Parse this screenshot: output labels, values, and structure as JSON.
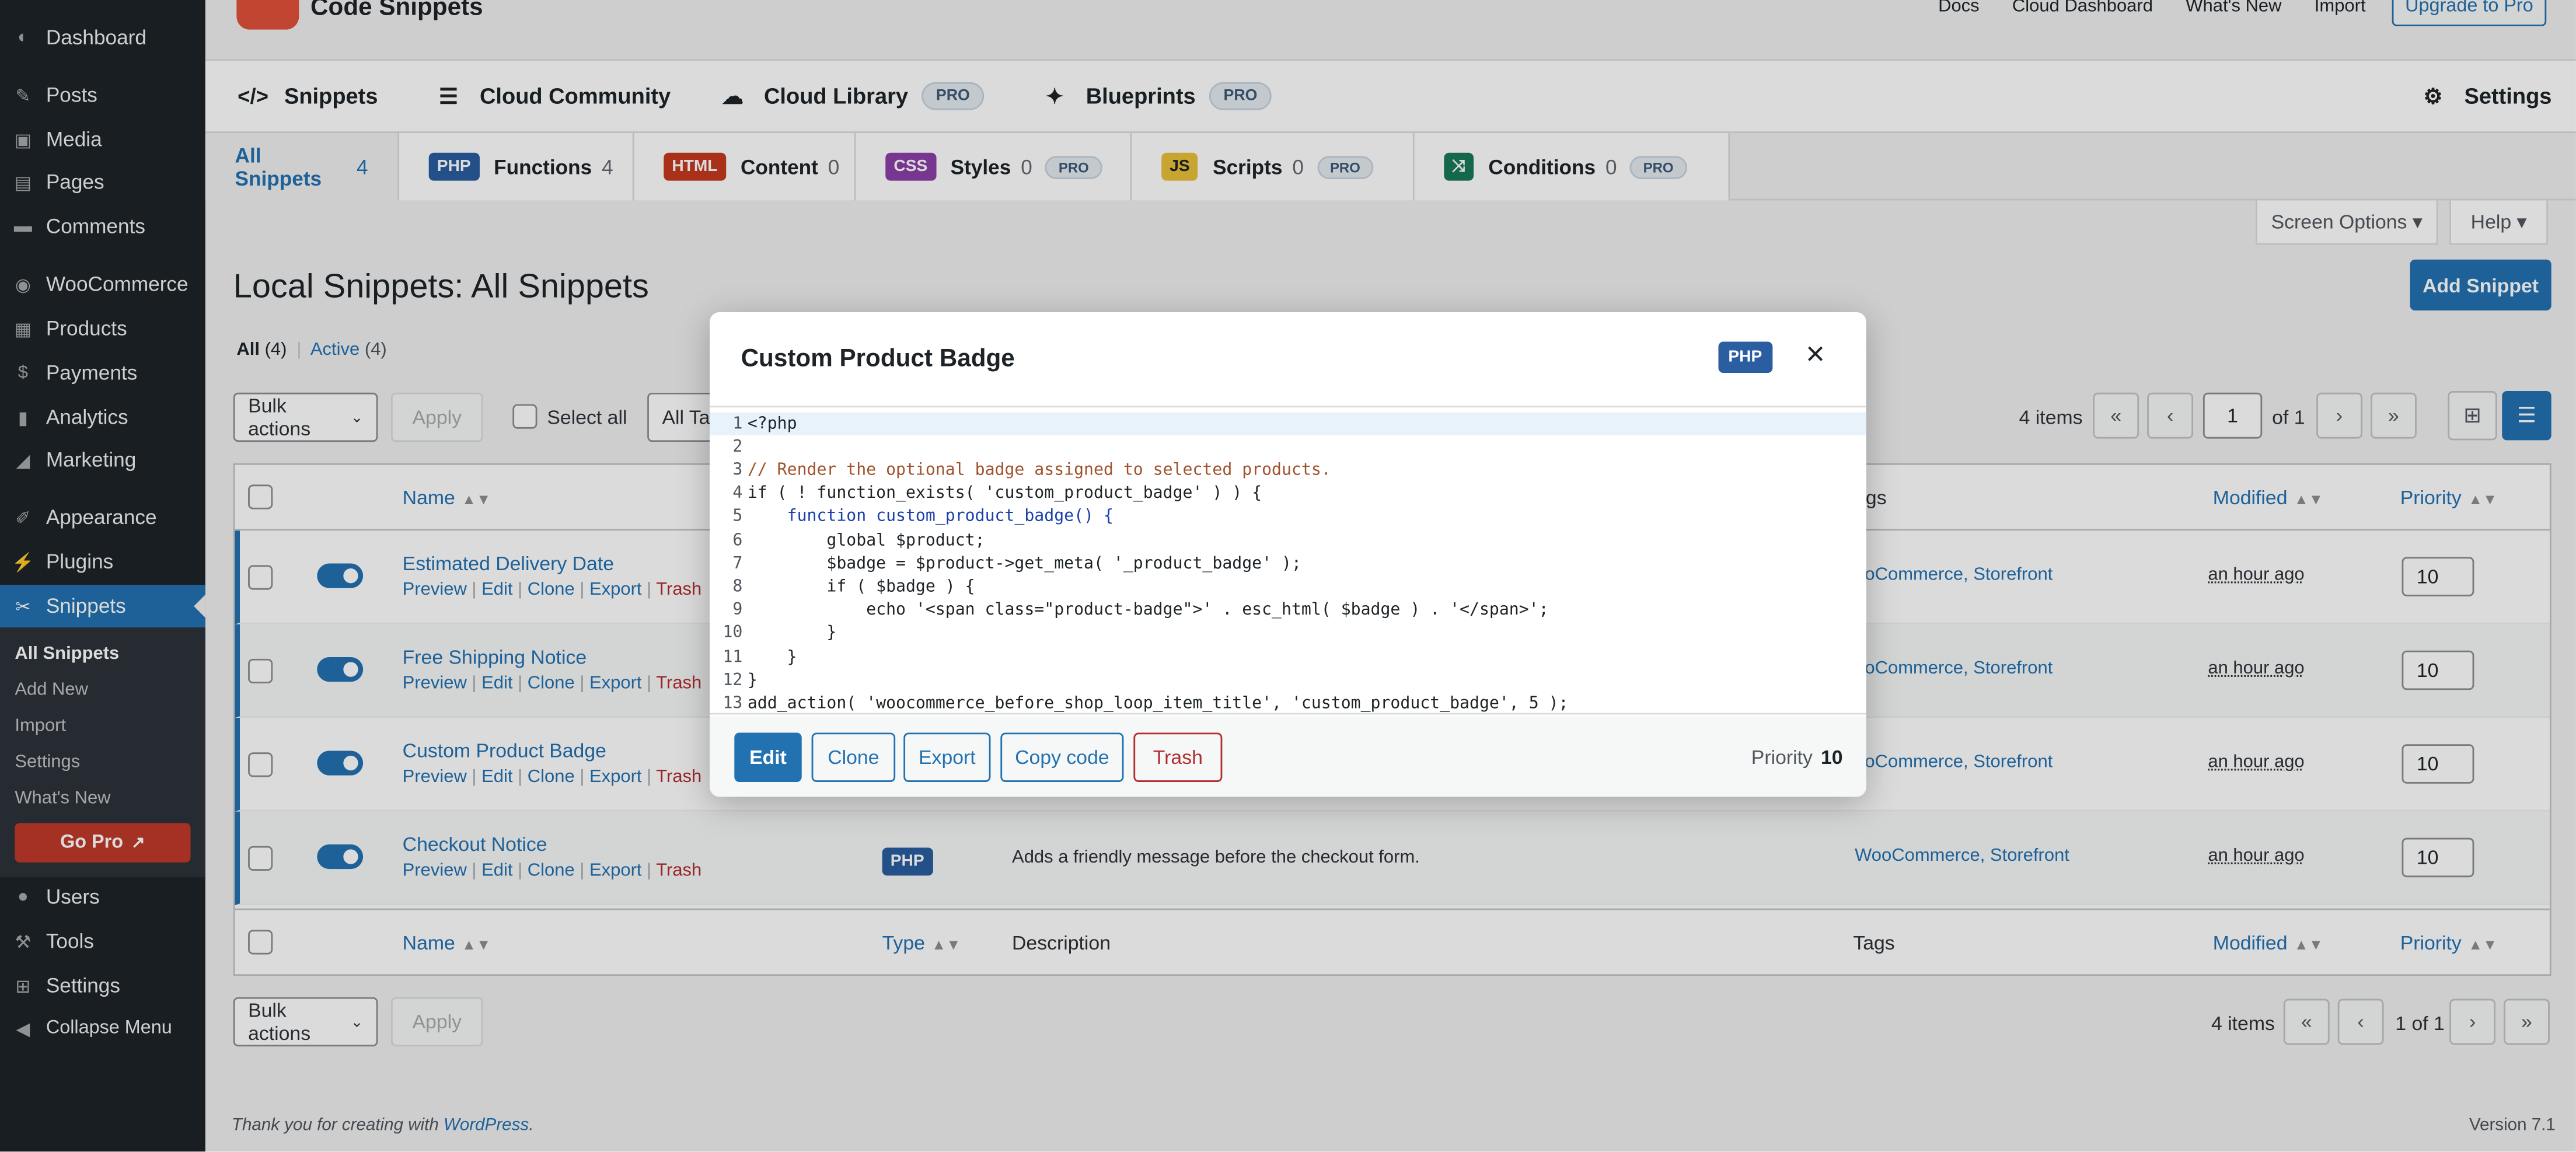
{
  "sidebar": {
    "items": [
      {
        "label": "Dashboard",
        "icon": "dashboard-icon"
      },
      {
        "label": "Posts",
        "icon": "pin-icon"
      },
      {
        "label": "Media",
        "icon": "media-icon"
      },
      {
        "label": "Pages",
        "icon": "pages-icon"
      },
      {
        "label": "Comments",
        "icon": "comment-icon"
      },
      {
        "label": "WooCommerce",
        "icon": "woo-icon"
      },
      {
        "label": "Products",
        "icon": "archive-icon"
      },
      {
        "label": "Payments",
        "icon": "dollar-icon"
      },
      {
        "label": "Analytics",
        "icon": "chart-icon"
      },
      {
        "label": "Marketing",
        "icon": "megaphone-icon"
      },
      {
        "label": "Appearance",
        "icon": "brush-icon"
      },
      {
        "label": "Plugins",
        "icon": "plug-icon"
      },
      {
        "label": "Snippets",
        "icon": "scissors-icon"
      },
      {
        "label": "Users",
        "icon": "user-icon"
      },
      {
        "label": "Tools",
        "icon": "wrench-icon"
      },
      {
        "label": "Settings",
        "icon": "settings-icon"
      },
      {
        "label": "Collapse Menu",
        "icon": "collapse-icon"
      }
    ],
    "submenu": [
      "All Snippets",
      "Add New",
      "Import",
      "Settings",
      "What's New"
    ],
    "gopro": "Go Pro"
  },
  "header": {
    "brand": "Code Snippets",
    "links": [
      "Docs",
      "Cloud Dashboard",
      "What's New",
      "Import"
    ],
    "upgrade": "Upgrade to Pro"
  },
  "nav": {
    "items": [
      "Snippets",
      "Cloud Community",
      "Cloud Library",
      "Blueprints"
    ],
    "pro": "PRO",
    "settings": "Settings"
  },
  "types": {
    "all": {
      "label": "All Snippets",
      "count": "4"
    },
    "tabs": [
      {
        "badge": "PHP",
        "label": "Functions",
        "count": "4"
      },
      {
        "badge": "HTML",
        "label": "Content",
        "count": "0"
      },
      {
        "badge": "CSS",
        "label": "Styles",
        "count": "0"
      },
      {
        "badge": "JS",
        "label": "Scripts",
        "count": "0"
      },
      {
        "badge": "⤨",
        "label": "Conditions",
        "count": "0"
      }
    ],
    "pro": "PRO"
  },
  "screen_options": "Screen Options ▾",
  "help": "Help ▾",
  "page": {
    "title": "Local Snippets: All Snippets",
    "add_button": "Add Snippet",
    "filter_all": "All",
    "filter_all_count": "(4)",
    "filter_sep": "|",
    "filter_active": "Active",
    "filter_active_count": "(4)"
  },
  "toolbar": {
    "bulk": "Bulk actions",
    "apply": "Apply",
    "select_all": "Select all",
    "all_tags": "All Tag",
    "items": "4 items",
    "page": "1",
    "of": "of 1",
    "first": "«",
    "prev": "‹",
    "next": "›",
    "last": "»",
    "bottom_pages": "1 of 1"
  },
  "columns": {
    "name": "Name",
    "type": "Type",
    "description": "Description",
    "tags": "Tags",
    "tags_partial": "ags",
    "modified": "Modified",
    "priority": "Priority"
  },
  "row_actions": {
    "preview": "Preview",
    "edit": "Edit",
    "clone": "Clone",
    "export": "Export",
    "trash": "Trash",
    "sep": "|"
  },
  "rows": [
    {
      "name": "Estimated Delivery Date",
      "tag1": "oo",
      "tag1b": "Commerce",
      "tag2": "Storefront",
      "tag_sep": ",",
      "modified": "an hour ago",
      "priority": "10"
    },
    {
      "name": "Free Shipping Notice",
      "tag1": "oo",
      "tag1b": "Commerce",
      "tag2": "Storefront",
      "tag_sep": ",",
      "modified": "an hour ago",
      "priority": "10"
    },
    {
      "name": "Custom Product Badge",
      "tag1": "oo",
      "tag1b": "Commerce",
      "tag2": "Storefront",
      "tag_sep": ",",
      "modified": "an hour ago",
      "priority": "10"
    },
    {
      "name": "Checkout Notice",
      "type": "PHP",
      "description": "Adds a friendly message before the checkout form.",
      "tag1": "Woo",
      "tag1b": "Commerce",
      "tag2": "Storefront",
      "tag_sep": ",",
      "modified": "an hour ago",
      "priority": "10"
    }
  ],
  "footer": {
    "note": "Thank you for creating with",
    "link": "WordPress",
    "period": ".",
    "version": "Version 7.1"
  },
  "modal": {
    "title": "Custom Product Badge",
    "badge": "PHP",
    "close": "×",
    "code": [
      "<?php",
      "",
      "// Render the optional badge assigned to selected products.",
      "if ( ! function_exists( 'custom_product_badge' ) ) {",
      "    function custom_product_badge() {",
      "        global $product;",
      "        $badge = $product->get_meta( '_product_badge' );",
      "        if ( $badge ) {",
      "            echo '<span class=\"product-badge\">' . esc_html( $badge ) . '</span>';",
      "        }",
      "    }",
      "}",
      "add_action( 'woocommerce_before_shop_loop_item_title', 'custom_product_badge', 5 );"
    ],
    "buttons": {
      "edit": "Edit",
      "clone": "Clone",
      "export": "Export",
      "copy": "Copy code",
      "trash": "Trash"
    },
    "priority_label": "Priority",
    "priority_value": "10"
  }
}
